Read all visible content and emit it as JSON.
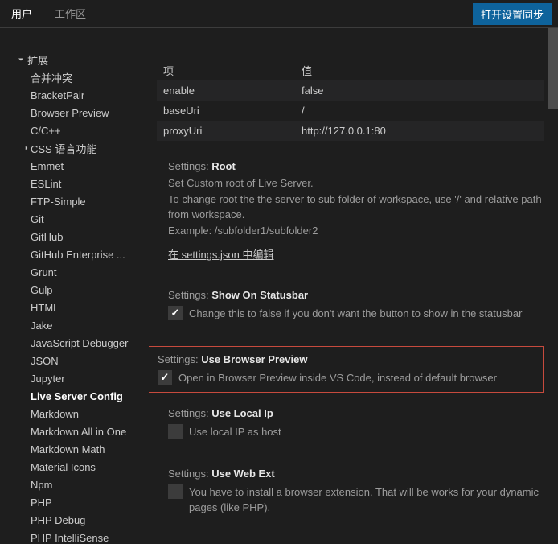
{
  "header": {
    "tabs": [
      {
        "label": "用户",
        "active": true
      },
      {
        "label": "工作区",
        "active": false
      }
    ],
    "sync_button": "打开设置同步"
  },
  "sidebar": {
    "section_label": "扩展",
    "items": [
      {
        "label": "合并冲突"
      },
      {
        "label": "BracketPair"
      },
      {
        "label": "Browser Preview"
      },
      {
        "label": "C/C++"
      },
      {
        "label": "CSS 语言功能",
        "expandable": true
      },
      {
        "label": "Emmet"
      },
      {
        "label": "ESLint"
      },
      {
        "label": "FTP-Simple"
      },
      {
        "label": "Git"
      },
      {
        "label": "GitHub"
      },
      {
        "label": "GitHub Enterprise ..."
      },
      {
        "label": "Grunt"
      },
      {
        "label": "Gulp"
      },
      {
        "label": "HTML"
      },
      {
        "label": "Jake"
      },
      {
        "label": "JavaScript Debugger"
      },
      {
        "label": "JSON"
      },
      {
        "label": "Jupyter"
      },
      {
        "label": "Live Server Config",
        "selected": true
      },
      {
        "label": "Markdown"
      },
      {
        "label": "Markdown All in One"
      },
      {
        "label": "Markdown Math"
      },
      {
        "label": "Material Icons"
      },
      {
        "label": "Npm"
      },
      {
        "label": "PHP"
      },
      {
        "label": "PHP Debug"
      },
      {
        "label": "PHP IntelliSense"
      }
    ]
  },
  "table": {
    "header_key": "项",
    "header_val": "值",
    "rows": [
      {
        "k": "enable",
        "v": "false"
      },
      {
        "k": "baseUri",
        "v": "/"
      },
      {
        "k": "proxyUri",
        "v": "http://127.0.0.1:80"
      }
    ]
  },
  "settings": {
    "prefix": "Settings:",
    "root": {
      "name": "Root",
      "desc1": "Set Custom root of Live Server.",
      "desc2": "To change root the the server to sub folder of workspace, use '/' and relative path from workspace.",
      "desc3": "Example: /subfolder1/subfolder2",
      "link": "在 settings.json 中编辑"
    },
    "show_statusbar": {
      "name": "Show On Statusbar",
      "desc": "Change this to false if you don't want the button to show in the statusbar",
      "checked": true
    },
    "use_browser_preview": {
      "name": "Use Browser Preview",
      "desc": "Open in Browser Preview inside VS Code, instead of default browser",
      "checked": true
    },
    "use_local_ip": {
      "name": "Use Local Ip",
      "desc": "Use local IP as host",
      "checked": false
    },
    "use_web_ext": {
      "name": "Use Web Ext",
      "desc": "You have to install a browser extension. That will be works for your dynamic pages (like PHP).",
      "checked": false
    }
  }
}
